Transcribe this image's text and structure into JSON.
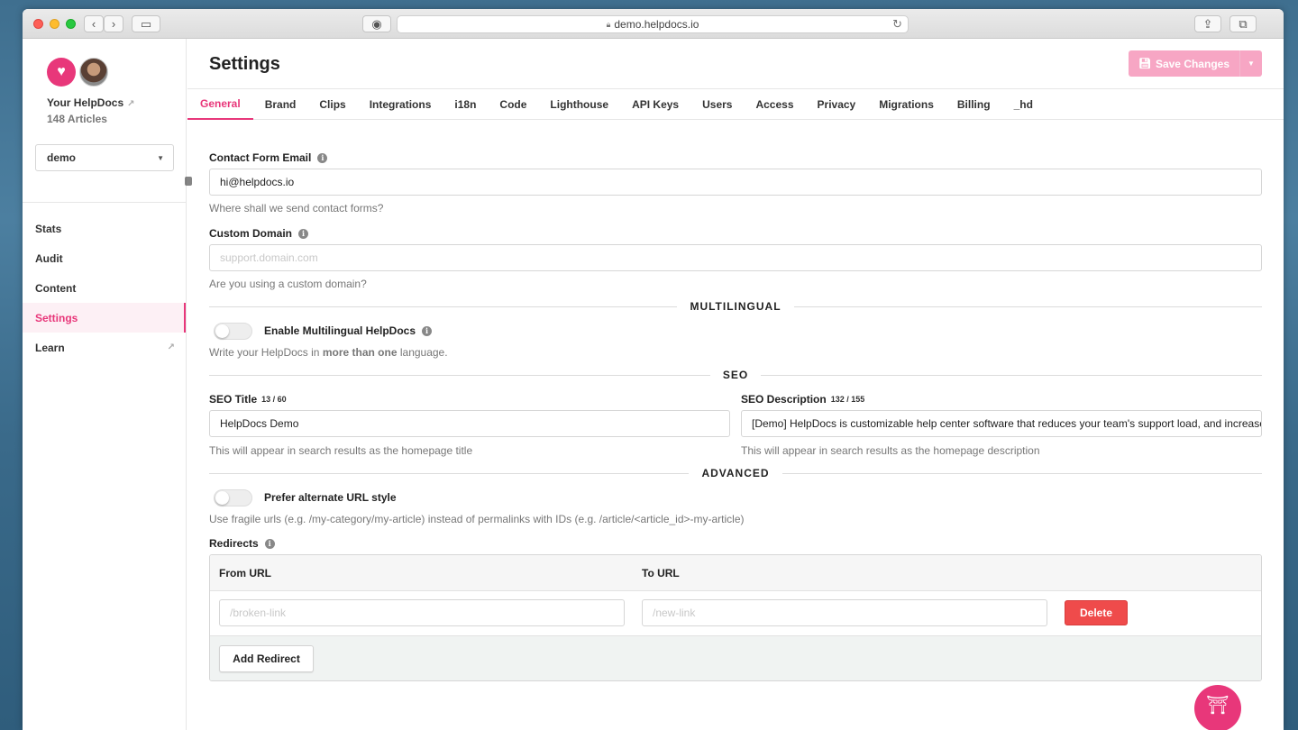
{
  "browser": {
    "url": "demo.helpdocs.io"
  },
  "sidebar": {
    "org_name": "Your HelpDocs",
    "article_count": "148 Articles",
    "site_select": "demo",
    "items": [
      {
        "label": "Stats"
      },
      {
        "label": "Audit"
      },
      {
        "label": "Content"
      },
      {
        "label": "Settings"
      },
      {
        "label": "Learn"
      }
    ]
  },
  "header": {
    "title": "Settings",
    "save_label": "Save Changes"
  },
  "tabs": [
    {
      "label": "General"
    },
    {
      "label": "Brand"
    },
    {
      "label": "Clips"
    },
    {
      "label": "Integrations"
    },
    {
      "label": "i18n"
    },
    {
      "label": "Code"
    },
    {
      "label": "Lighthouse"
    },
    {
      "label": "API Keys"
    },
    {
      "label": "Users"
    },
    {
      "label": "Access"
    },
    {
      "label": "Privacy"
    },
    {
      "label": "Migrations"
    },
    {
      "label": "Billing"
    },
    {
      "label": "_hd"
    }
  ],
  "form": {
    "contact_email_label": "Contact Form Email",
    "contact_email_value": "hi@helpdocs.io",
    "contact_email_help": "Where shall we send contact forms?",
    "custom_domain_label": "Custom Domain",
    "custom_domain_placeholder": "support.domain.com",
    "custom_domain_help": "Are you using a custom domain?",
    "multilingual_heading": "MULTILINGUAL",
    "multilingual_toggle_label": "Enable Multilingual HelpDocs",
    "multilingual_help_prefix": "Write your HelpDocs in ",
    "multilingual_help_bold": "more than one",
    "multilingual_help_suffix": " language.",
    "seo_heading": "SEO",
    "seo_title_label": "SEO Title",
    "seo_title_counter": "13 / 60",
    "seo_title_value": "HelpDocs Demo",
    "seo_title_help": "This will appear in search results as the homepage title",
    "seo_desc_label": "SEO Description",
    "seo_desc_counter": "132 / 155",
    "seo_desc_value": "[Demo] HelpDocs is customizable help center software that reduces your team's support load, and increases yo",
    "seo_desc_help": "This will appear in search results as the homepage description",
    "advanced_heading": "ADVANCED",
    "url_style_toggle_label": "Prefer alternate URL style",
    "url_style_help": "Use fragile urls (e.g. /my-category/my-article) instead of permalinks with IDs (e.g. /article/<article_id>-my-article)",
    "redirects_label": "Redirects"
  },
  "redirects": {
    "from_header": "From URL",
    "to_header": "To URL",
    "from_placeholder": "/broken-link",
    "to_placeholder": "/new-link",
    "delete_label": "Delete",
    "add_label": "Add Redirect"
  },
  "colors": {
    "brand": "#e8377a",
    "save_button": "#f7a6c4",
    "delete": "#ef4b4b"
  },
  "icons": {
    "logo": "helpdocs-logo-icon",
    "external": "external-link-icon",
    "info": "info-icon",
    "save": "floppy-icon",
    "launcher": "help-launcher-icon"
  }
}
